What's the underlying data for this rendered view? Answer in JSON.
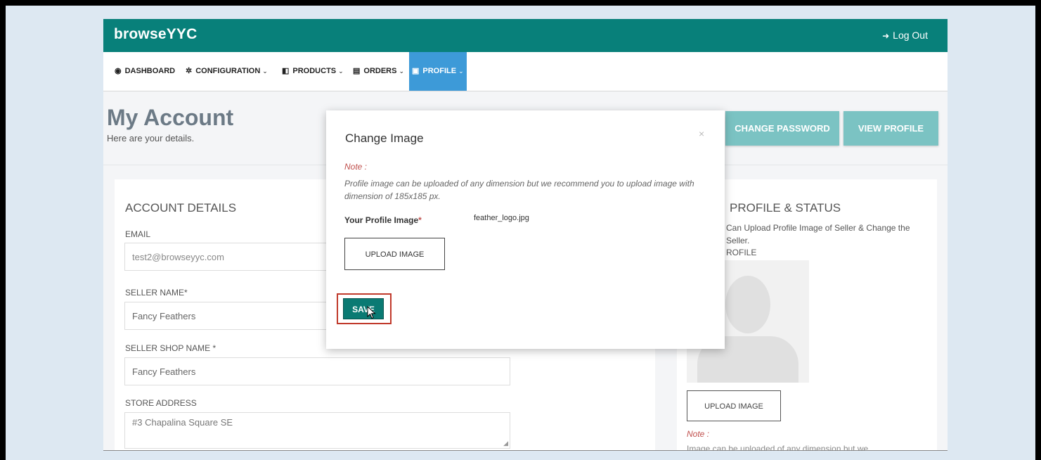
{
  "app": {
    "brand": "browseYYC",
    "logout_label": "Log Out"
  },
  "nav": [
    {
      "icon": "dashboard-icon",
      "label": "DASHBOARD",
      "has_chevron": false
    },
    {
      "icon": "gear-icon",
      "label": "CONFIGURATION",
      "has_chevron": true
    },
    {
      "icon": "products-icon",
      "label": "PRODUCTS",
      "has_chevron": true
    },
    {
      "icon": "orders-icon",
      "label": "ORDERS",
      "has_chevron": true
    },
    {
      "icon": "profile-icon",
      "label": "PROFILE",
      "has_chevron": true,
      "active": true
    }
  ],
  "header": {
    "title": "My Account",
    "subtitle": "Here are your details.",
    "change_password_label": "CHANGE PASSWORD",
    "view_profile_label": "VIEW PROFILE"
  },
  "account": {
    "title": "ACCOUNT DETAILS",
    "email_label": "EMAIL",
    "email_value": "test2@browseyyc.com",
    "seller_name_label": "SELLER NAME*",
    "seller_name_value": "Fancy Feathers",
    "shop_name_label": "SELLER SHOP NAME *",
    "shop_name_value": "Fancy Feathers",
    "store_address_label": "STORE ADDRESS",
    "store_address_value": "#3 Chapalina Square SE"
  },
  "profile_panel": {
    "title_partial": "PROFILE & STATUS",
    "desc_line1": "Can Upload Profile Image of Seller & Change the",
    "desc_line2": "Seller.",
    "profile_label": "ROFILE",
    "upload_label": "UPLOAD IMAGE",
    "note_label": "Note :",
    "note_partial": "Image can be uploaded of any dimension but we"
  },
  "modal": {
    "title": "Change Image",
    "close": "×",
    "note_label": "Note :",
    "note_text": "Profile image can be uploaded of any dimension but we recommend you to upload image with dimension of 185x185 px.",
    "image_label": "Your Profile Image",
    "required_mark": "*",
    "file_name": "feather_logo.jpg",
    "upload_label": "UPLOAD IMAGE",
    "save_label": "SAVE"
  },
  "colors": {
    "brand_teal": "#08807a",
    "active_nav": "#3d9ad8",
    "header_button": "#7bc3c3",
    "save_button": "#0a7a73",
    "highlight_red": "#c0392b"
  }
}
